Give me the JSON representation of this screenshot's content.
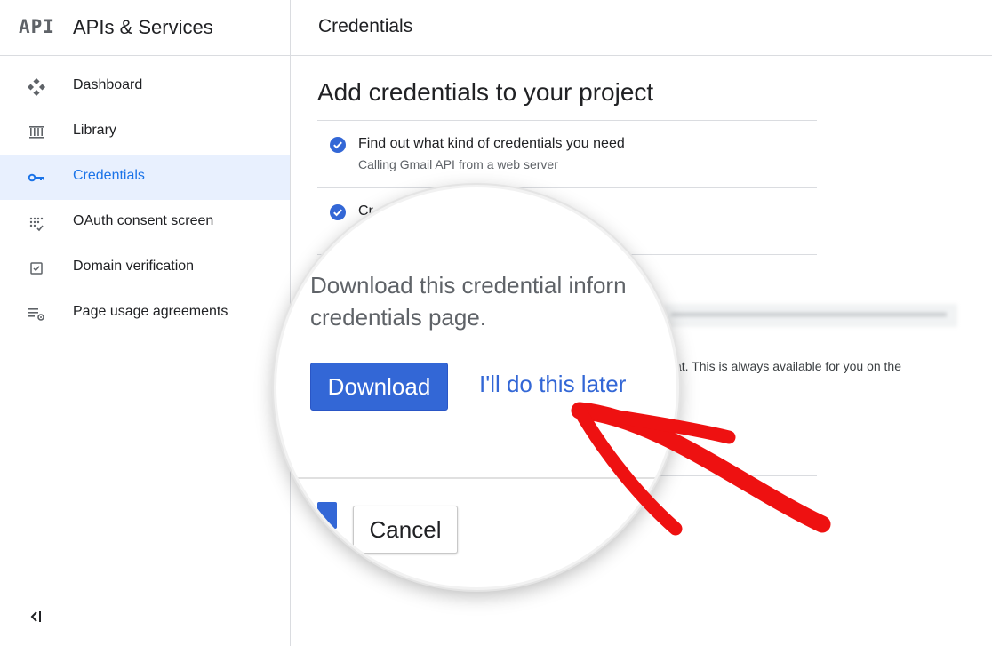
{
  "sidebar": {
    "logo": "API",
    "title": "APIs & Services",
    "items": [
      {
        "label": "Dashboard",
        "icon": "dashboard-icon"
      },
      {
        "label": "Library",
        "icon": "library-icon"
      },
      {
        "label": "Credentials",
        "icon": "key-icon",
        "active": true
      },
      {
        "label": "OAuth consent screen",
        "icon": "oauth-icon"
      },
      {
        "label": "Domain verification",
        "icon": "checkbox-icon"
      },
      {
        "label": "Page usage agreements",
        "icon": "settings-list-icon"
      }
    ],
    "collapse_icon": "collapse-icon"
  },
  "header": {
    "title": "Credentials"
  },
  "main": {
    "heading": "Add credentials to your project",
    "steps": [
      {
        "title": "Find out what kind of credentials you need",
        "subtitle": "Calling Gmail API from a web server"
      },
      {
        "title": "Cr",
        "subtitle": ""
      }
    ],
    "background_text": "at. This is always available for you on the"
  },
  "magnifier": {
    "text_line1": "Download this credential inforn",
    "text_line2": "credentials page.",
    "download_label": "Download",
    "later_label": "I'll do this later",
    "cancel_label": "Cancel"
  },
  "colors": {
    "accent": "#1a73e8",
    "button": "#3367d6",
    "arrow": "#ee1111",
    "active_bg": "#e8f0fe"
  }
}
